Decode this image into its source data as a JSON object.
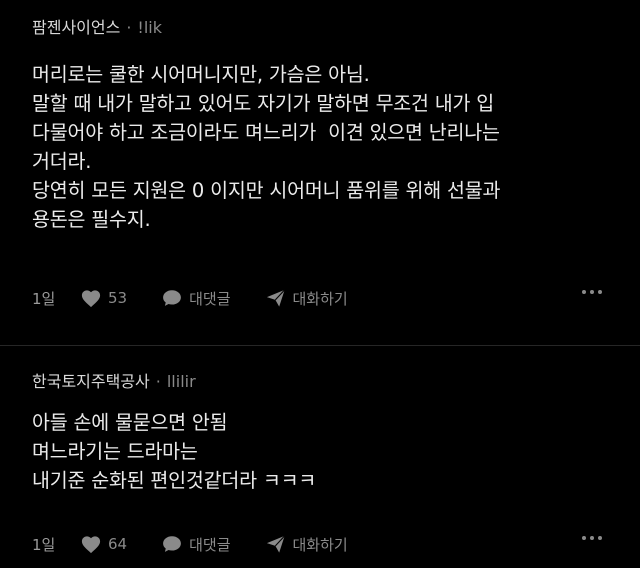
{
  "posts": [
    {
      "author": "팜젠사이언스",
      "separator": "·",
      "handle": "!lik",
      "lines": [
        "머리로는 쿨한 시어머니지만, 가슴은 아님.",
        "말할 때 내가 말하고 있어도 자기가 말하면 무조건 내가 입",
        "다물어야 하고 조금이라도 며느리가  이견 있으면 난리나는",
        "거더라.",
        "당연히 모든 지원은 0 이지만 시어머니 품위를 위해 선물과",
        "용돈은 필수지."
      ],
      "time": "1일",
      "likes": "53",
      "reply_label": "대댓글",
      "dm_label": "대화하기"
    },
    {
      "author": "한국토지주택공사",
      "separator": "·",
      "handle": "llilir",
      "lines": [
        "아들 손에 물묻으면 안됨",
        "며느라기는 드라마는",
        "내기준 순화된 편인것같더라 ㅋㅋㅋ"
      ],
      "time": "1일",
      "likes": "64",
      "reply_label": "대댓글",
      "dm_label": "대화하기"
    }
  ],
  "icons": {
    "like": "heart-icon",
    "reply": "chat-bubble-icon",
    "dm": "paper-plane-icon",
    "more": "more-dots-icon"
  },
  "colors": {
    "background": "#000000",
    "text": "#ebebeb",
    "muted": "#8a8a8a",
    "divider": "#262626"
  }
}
